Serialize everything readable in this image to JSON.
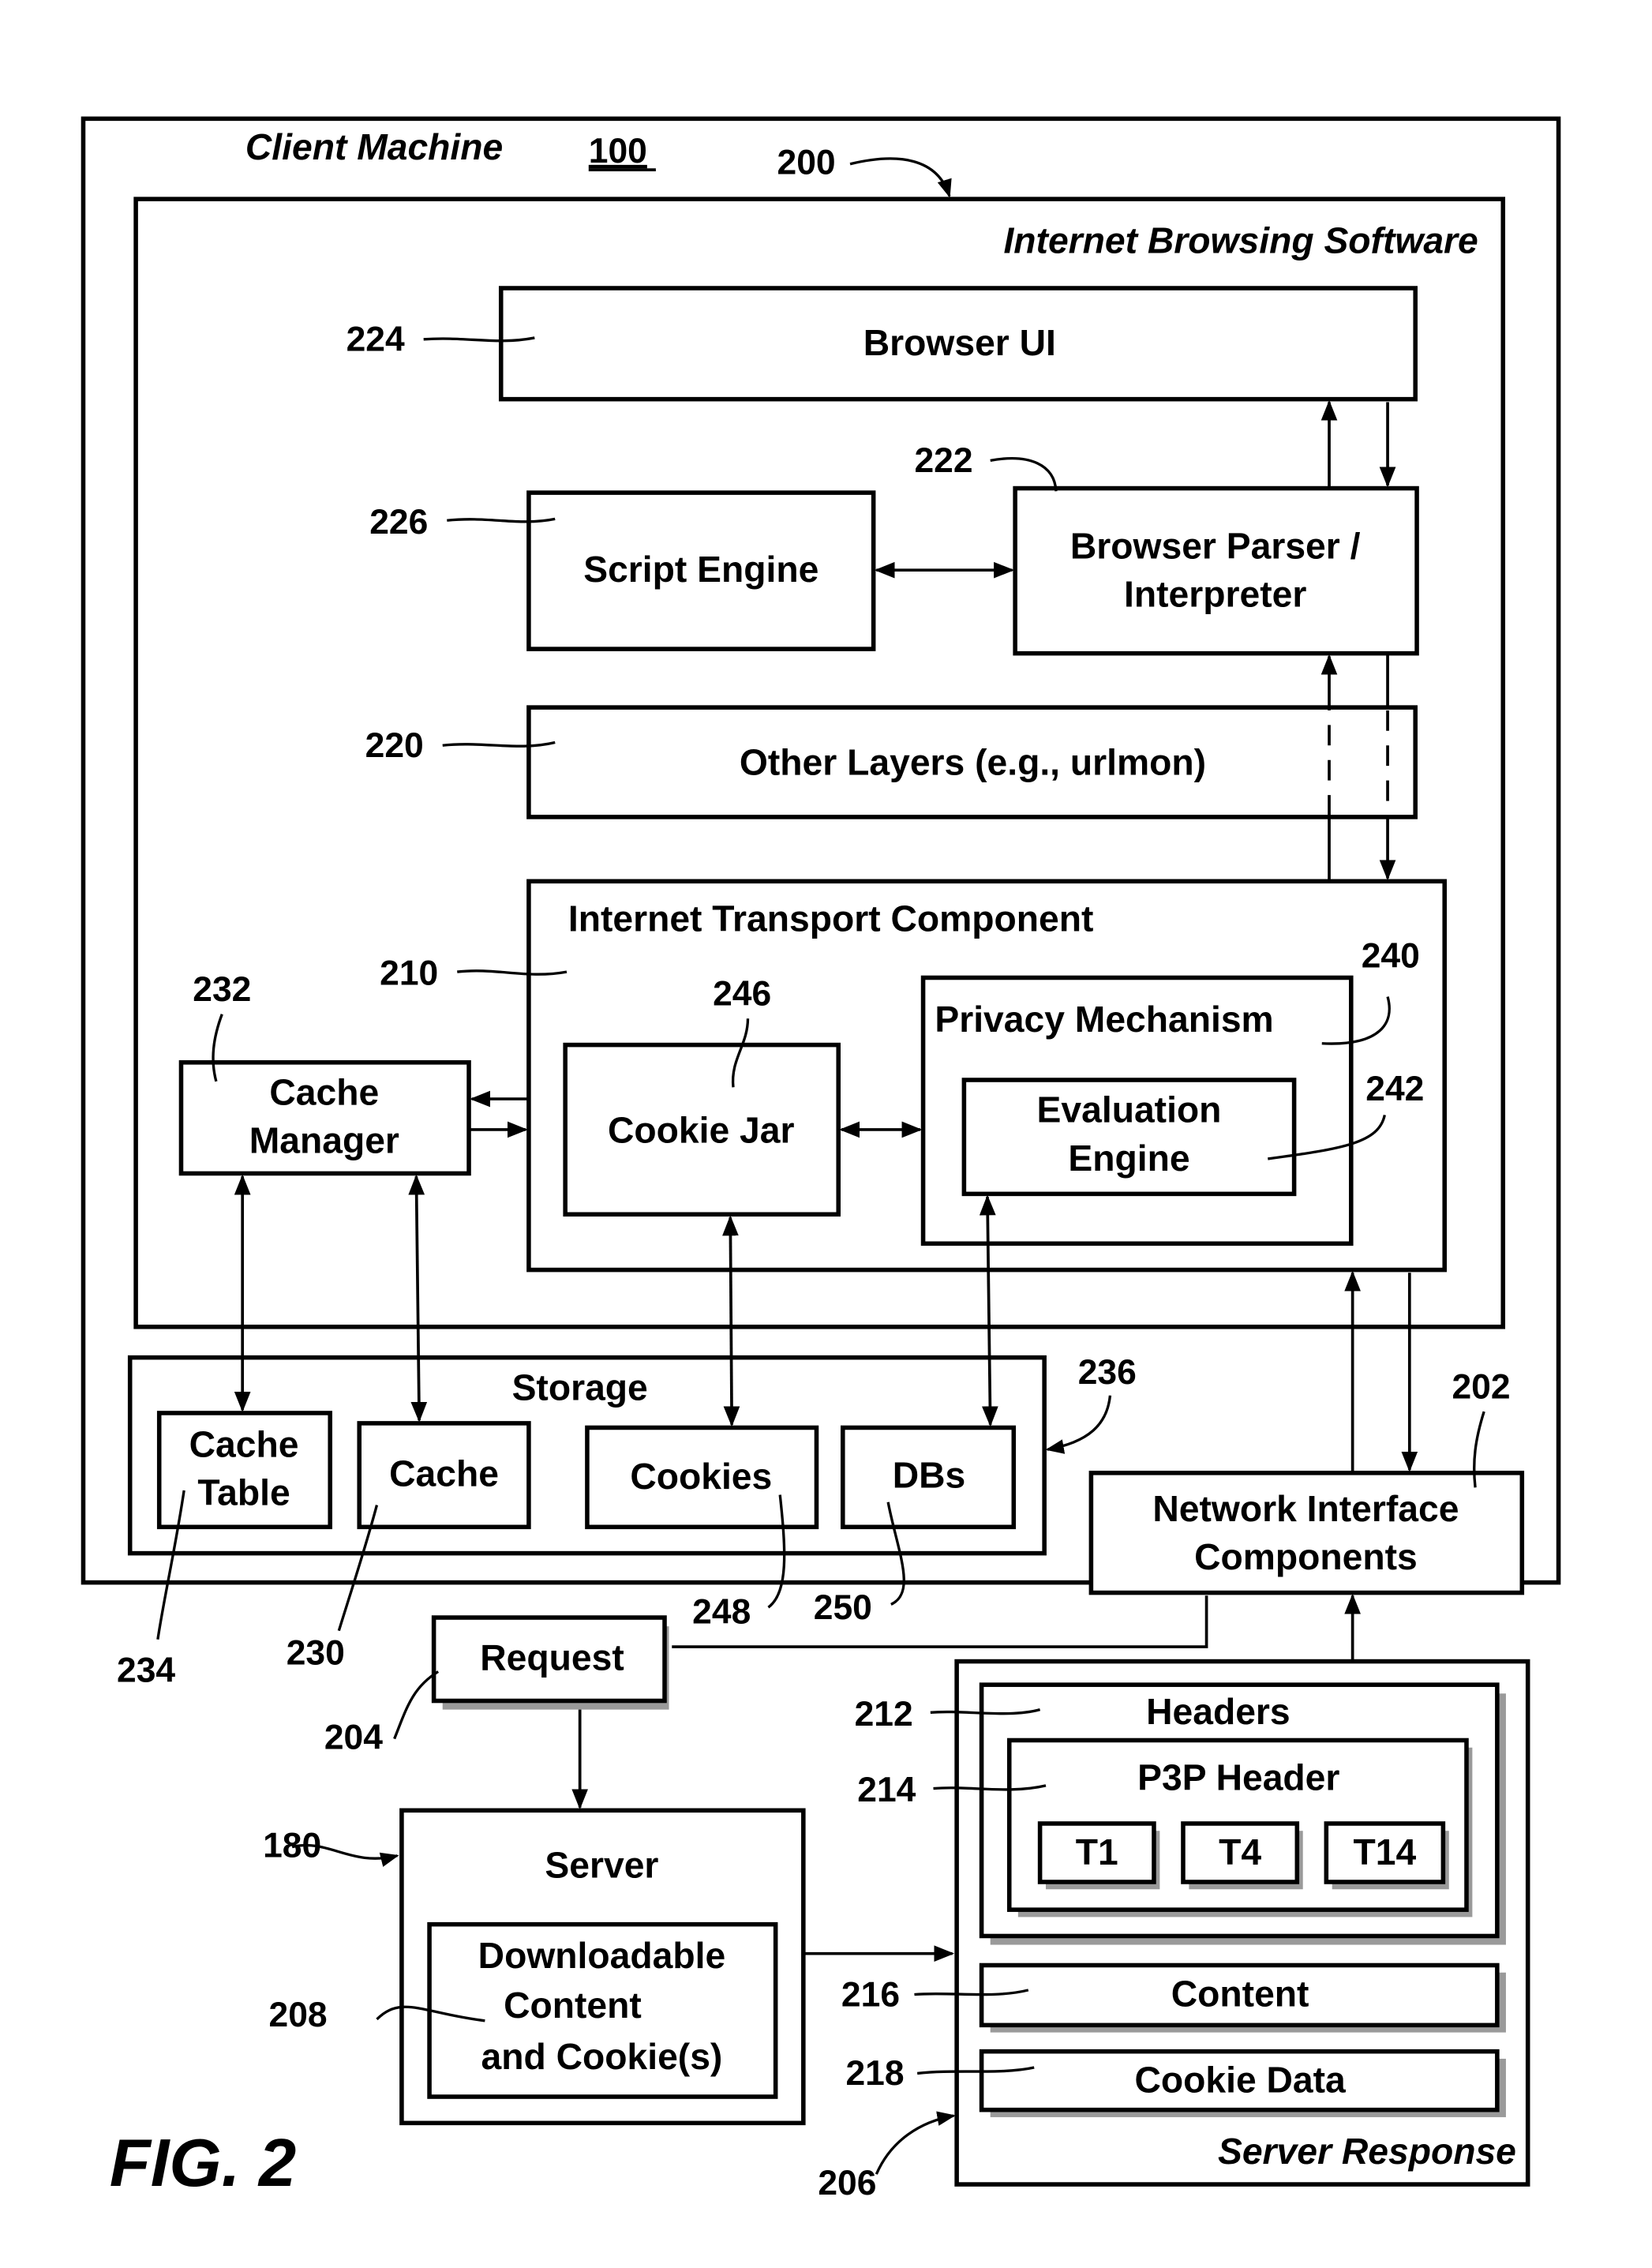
{
  "figure": {
    "label": "FIG. 2"
  },
  "client_machine": {
    "title": "Client Machine",
    "ref": "100"
  },
  "browsing_software": {
    "title": "Internet Browsing Software",
    "ref": "200"
  },
  "components": {
    "browser_ui": {
      "label": "Browser UI",
      "ref": "224"
    },
    "script_engine": {
      "label": "Script Engine",
      "ref": "226"
    },
    "parser": {
      "line1": "Browser Parser /",
      "line2": "Interpreter",
      "ref": "222"
    },
    "other_layers": {
      "label": "Other Layers (e.g., urlmon)",
      "ref": "220"
    },
    "transport": {
      "label": "Internet Transport Component",
      "ref": "210"
    },
    "cookie_jar": {
      "label": "Cookie Jar",
      "ref": "246"
    },
    "privacy": {
      "label": "Privacy Mechanism",
      "ref": "240"
    },
    "evaluation": {
      "line1": "Evaluation",
      "line2": "Engine",
      "ref": "242"
    },
    "cache_manager": {
      "line1": "Cache",
      "line2": "Manager",
      "ref": "232"
    },
    "network_interface": {
      "line1": "Network Interface",
      "line2": "Components",
      "ref": "202"
    }
  },
  "storage": {
    "title": "Storage",
    "ref": "236",
    "items": [
      {
        "line1": "Cache",
        "line2": "Table",
        "ref": "234"
      },
      {
        "line1": "Cache",
        "line2": "",
        "ref": "230"
      },
      {
        "line1": "Cookies",
        "line2": "",
        "ref": "248"
      },
      {
        "line1": "DBs",
        "line2": "",
        "ref": "250"
      }
    ]
  },
  "request": {
    "label": "Request",
    "ref": "204"
  },
  "server": {
    "title": "Server",
    "ref": "180",
    "content": {
      "line1": "Downloadable",
      "line2": "Content",
      "line3": "and Cookie(s)",
      "ref": "208"
    }
  },
  "server_response": {
    "title": "Server Response",
    "ref": "206",
    "headers": {
      "label": "Headers",
      "ref": "212"
    },
    "p3p": {
      "label": "P3P Header",
      "ref": "214",
      "tokens": [
        "T1",
        "T4",
        "T14"
      ]
    },
    "content": {
      "label": "Content",
      "ref": "216"
    },
    "cookie_data": {
      "label": "Cookie Data",
      "ref": "218"
    }
  }
}
